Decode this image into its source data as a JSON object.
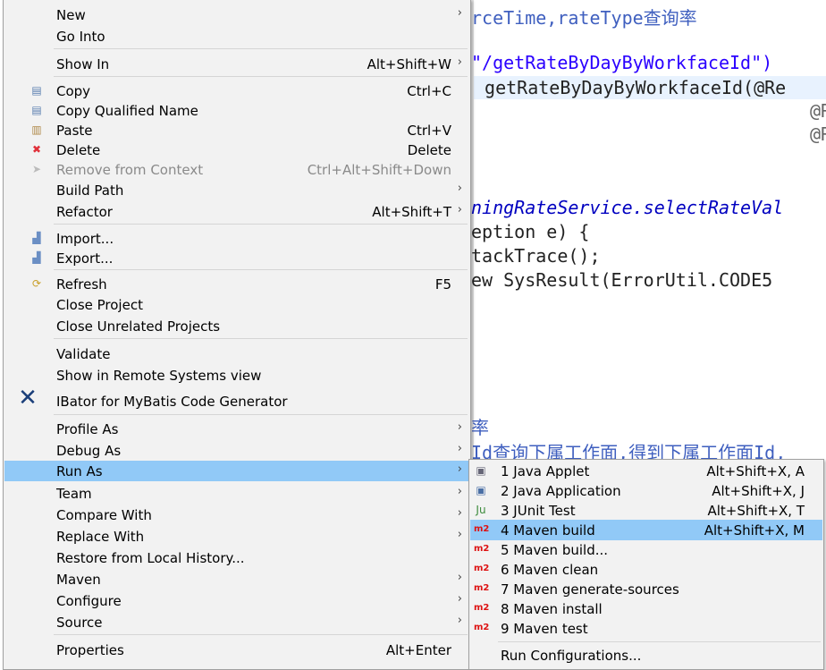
{
  "editor": {
    "lines": [
      {
        "text": "rceTime,rateType查询率",
        "cls": "comment"
      },
      {
        "text": "\"/getRateByDayByWorkfaceId\")",
        "cls": "str"
      },
      {
        "text": " getRateByDayByWorkfaceId(@Re",
        "cls": ""
      },
      {
        "text": "@R",
        "cls": "ann"
      },
      {
        "text": "@R",
        "cls": "ann"
      },
      {
        "text": "ningRateService.selectRateVal",
        "cls": "ital"
      },
      {
        "text": "eption e) {",
        "cls": ""
      },
      {
        "text": "tackTrace();",
        "cls": ""
      },
      {
        "text": "ew SysResult(ErrorUtil.CODE5",
        "cls": ""
      },
      {
        "text": "率",
        "cls": "comment"
      },
      {
        "text": "Id查询下属工作面,得到下属工作面Id,",
        "cls": "comment"
      }
    ]
  },
  "main_menu": {
    "items": [
      {
        "label": "New",
        "submenu": true
      },
      {
        "label": "Go Into"
      },
      {
        "sep": true
      },
      {
        "label": "Show In",
        "shortcut": "Alt+Shift+W",
        "submenu": true
      },
      {
        "sep": true
      },
      {
        "label": "Copy",
        "shortcut": "Ctrl+C",
        "icon": "copy-icon"
      },
      {
        "label": "Copy Qualified Name",
        "icon": "copy-qualified-name-icon"
      },
      {
        "label": "Paste",
        "shortcut": "Ctrl+V",
        "icon": "paste-icon"
      },
      {
        "label": "Delete",
        "shortcut": "Delete",
        "icon": "delete-icon"
      },
      {
        "label": "Remove from Context",
        "shortcut": "Ctrl+Alt+Shift+Down",
        "icon": "remove-context-icon",
        "disabled": true
      },
      {
        "label": "Build Path",
        "submenu": true
      },
      {
        "label": "Refactor",
        "shortcut": "Alt+Shift+T",
        "submenu": true
      },
      {
        "sep": true
      },
      {
        "label": "Import...",
        "icon": "import-icon"
      },
      {
        "label": "Export...",
        "icon": "export-icon"
      },
      {
        "sep": true
      },
      {
        "label": "Refresh",
        "shortcut": "F5",
        "icon": "refresh-icon"
      },
      {
        "label": "Close Project"
      },
      {
        "label": "Close Unrelated Projects"
      },
      {
        "sep": true
      },
      {
        "label": "Validate"
      },
      {
        "label": "Show in Remote Systems view"
      },
      {
        "label": "IBator for MyBatis Code Generator",
        "icon": "ibator-icon"
      },
      {
        "sep": true
      },
      {
        "label": "Profile As",
        "submenu": true
      },
      {
        "label": "Debug As",
        "submenu": true
      },
      {
        "label": "Run As",
        "submenu": true,
        "selected": true
      },
      {
        "label": "Team",
        "submenu": true
      },
      {
        "label": "Compare With",
        "submenu": true
      },
      {
        "label": "Replace With",
        "submenu": true
      },
      {
        "label": "Restore from Local History..."
      },
      {
        "label": "Maven",
        "submenu": true
      },
      {
        "label": "Configure",
        "submenu": true
      },
      {
        "label": "Source",
        "submenu": true
      },
      {
        "sep": true
      },
      {
        "label": "Properties",
        "shortcut": "Alt+Enter"
      }
    ]
  },
  "run_as_menu": {
    "items": [
      {
        "label": "1 Java Applet",
        "shortcut": "Alt+Shift+X, A",
        "icon": "java-applet-icon"
      },
      {
        "label": "2 Java Application",
        "shortcut": "Alt+Shift+X, J",
        "icon": "java-application-icon"
      },
      {
        "label": "3 JUnit Test",
        "shortcut": "Alt+Shift+X, T",
        "icon": "junit-icon"
      },
      {
        "label": "4 Maven build",
        "shortcut": "Alt+Shift+X, M",
        "icon": "maven-icon",
        "selected": true
      },
      {
        "label": "5 Maven build...",
        "icon": "maven-icon"
      },
      {
        "label": "6 Maven clean",
        "icon": "maven-icon"
      },
      {
        "label": "7 Maven generate-sources",
        "icon": "maven-icon"
      },
      {
        "label": "8 Maven install",
        "icon": "maven-icon"
      },
      {
        "label": "9 Maven test",
        "icon": "maven-icon"
      },
      {
        "sep": true
      },
      {
        "label": "Run Configurations..."
      }
    ]
  },
  "colors": {
    "selection": "#91c9f7",
    "menu_bg": "#f2f2f2"
  }
}
